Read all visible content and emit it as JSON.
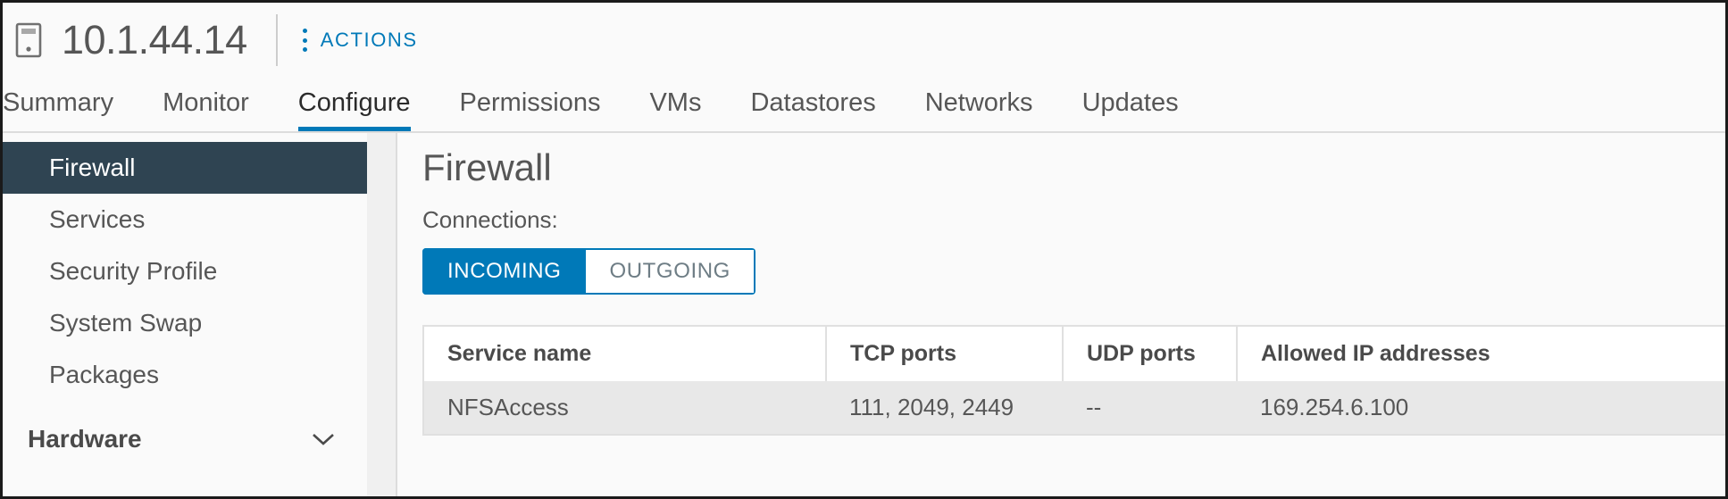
{
  "header": {
    "host_icon": "host-icon",
    "title": "10.1.44.14",
    "actions_label": "ACTIONS",
    "kebab_icon": "vertical-dots-icon"
  },
  "tabs": [
    {
      "label": "Summary",
      "active": false
    },
    {
      "label": "Monitor",
      "active": false
    },
    {
      "label": "Configure",
      "active": true
    },
    {
      "label": "Permissions",
      "active": false
    },
    {
      "label": "VMs",
      "active": false
    },
    {
      "label": "Datastores",
      "active": false
    },
    {
      "label": "Networks",
      "active": false
    },
    {
      "label": "Updates",
      "active": false
    }
  ],
  "sidebar": {
    "items": [
      {
        "label": "Firewall",
        "selected": true
      },
      {
        "label": "Services",
        "selected": false
      },
      {
        "label": "Security Profile",
        "selected": false
      },
      {
        "label": "System Swap",
        "selected": false
      },
      {
        "label": "Packages",
        "selected": false
      }
    ],
    "group": {
      "label": "Hardware",
      "chevron_icon": "chevron-down-icon"
    }
  },
  "main": {
    "title": "Firewall",
    "connections_label": "Connections:",
    "toggle": {
      "incoming": "INCOMING",
      "outgoing": "OUTGOING",
      "selected": "INCOMING"
    },
    "table": {
      "columns": [
        "Service name",
        "TCP ports",
        "UDP ports",
        "Allowed IP addresses"
      ],
      "rows": [
        {
          "service_name": "NFSAccess",
          "tcp_ports": "111, 2049, 2449",
          "udp_ports": "--",
          "allowed_ip": "169.254.6.100"
        }
      ]
    }
  },
  "colors": {
    "accent": "#0079b8",
    "sidebar_selected_bg": "#2f4452",
    "row_bg": "#e8e8e8",
    "text": "#565656"
  }
}
